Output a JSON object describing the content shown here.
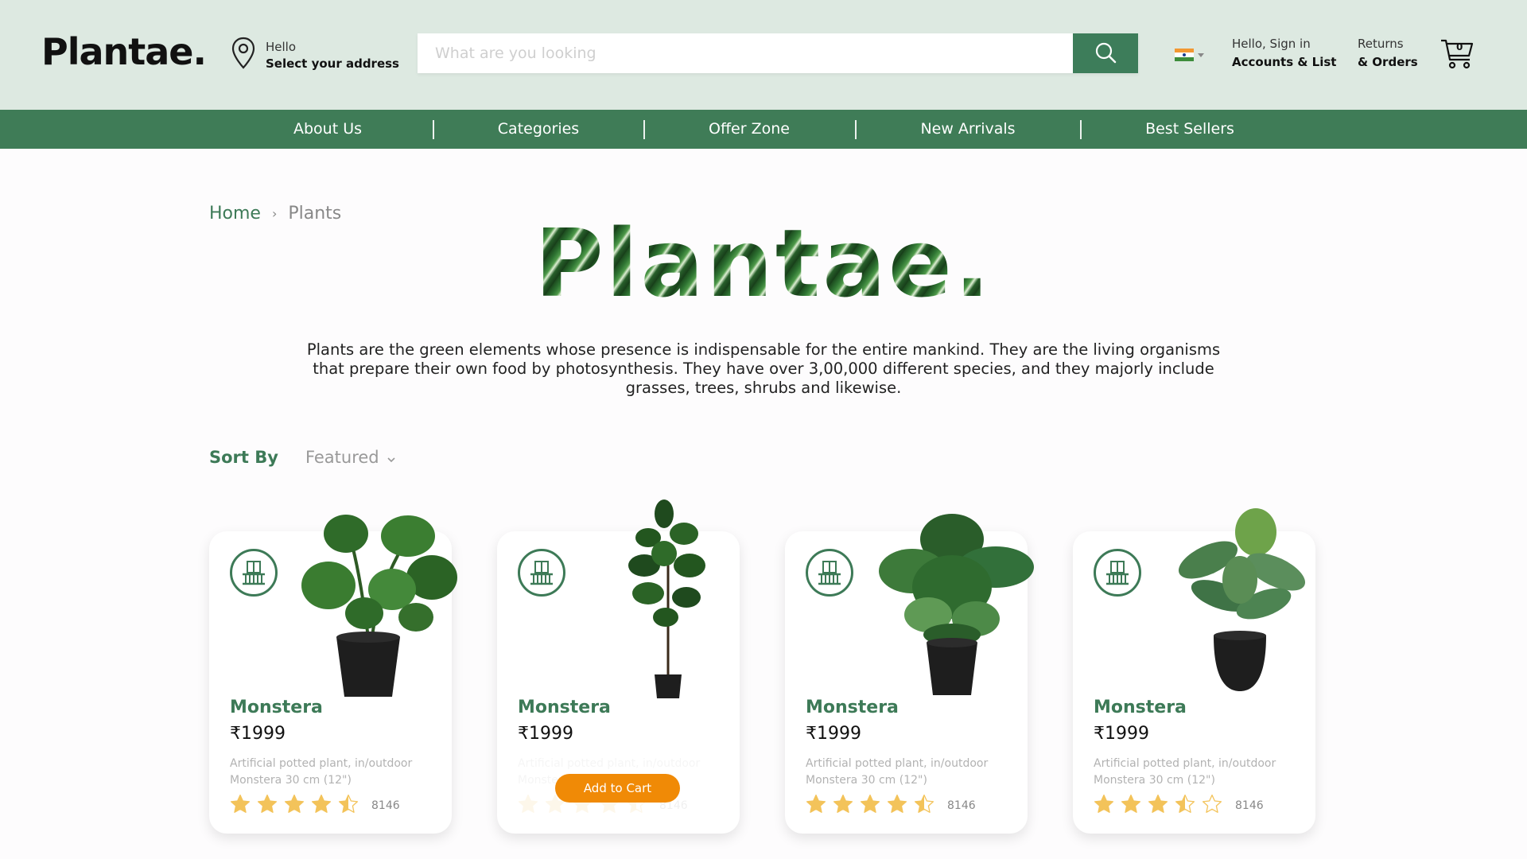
{
  "header": {
    "logo": "Plantae.",
    "address": {
      "greeting": "Hello",
      "action": "Select your address"
    },
    "search": {
      "placeholder": "What are you looking",
      "value": ""
    },
    "account": {
      "greeting": "Hello, Sign in",
      "label": "Accounts & List"
    },
    "returns": {
      "line1": "Returns",
      "line2": "& Orders"
    },
    "cart_count": "0",
    "flag": "india-flag-icon"
  },
  "nav": [
    "About Us",
    "Categories",
    "Offer Zone",
    "New Arrivals",
    "Best Sellers"
  ],
  "breadcrumb": {
    "home": "Home",
    "current": "Plants"
  },
  "hero": {
    "title": "Plantae.",
    "description": "Plants are the green elements whose presence is indispensable for the entire mankind. They are the living organisms that prepare their own food by photosynthesis. They have over 3,00,000 different species, and they majorly include grasses, trees, shrubs and likewise."
  },
  "sort": {
    "label": "Sort By",
    "selected": "Featured"
  },
  "products": [
    {
      "name": "Monstera",
      "price": "₹1999",
      "description": "Artificial potted plant, in/outdoor Monstera 30 cm (12\")",
      "rating": 4.5,
      "reviews": "8146"
    },
    {
      "name": "Monstera",
      "price": "₹1999",
      "description": "Artificial potted plant, in/outdoor Monstera 30 cm (12\")",
      "rating": 4.5,
      "reviews": "8146",
      "button": "Add to Cart"
    },
    {
      "name": "Monstera",
      "price": "₹1999",
      "description": "Artificial potted plant, in/outdoor Monstera 30 cm (12\")",
      "rating": 4.5,
      "reviews": "8146"
    },
    {
      "name": "Monstera",
      "price": "₹1999",
      "description": "Artificial potted plant, in/outdoor Monstera 30 cm (12\")",
      "rating": 3.5,
      "reviews": "8146"
    }
  ],
  "colors": {
    "accent": "#3d7a57",
    "header_bg": "#dde9e1",
    "nav_bg": "#3f7c57",
    "button": "#f08a06",
    "star": "#f3c35a"
  }
}
